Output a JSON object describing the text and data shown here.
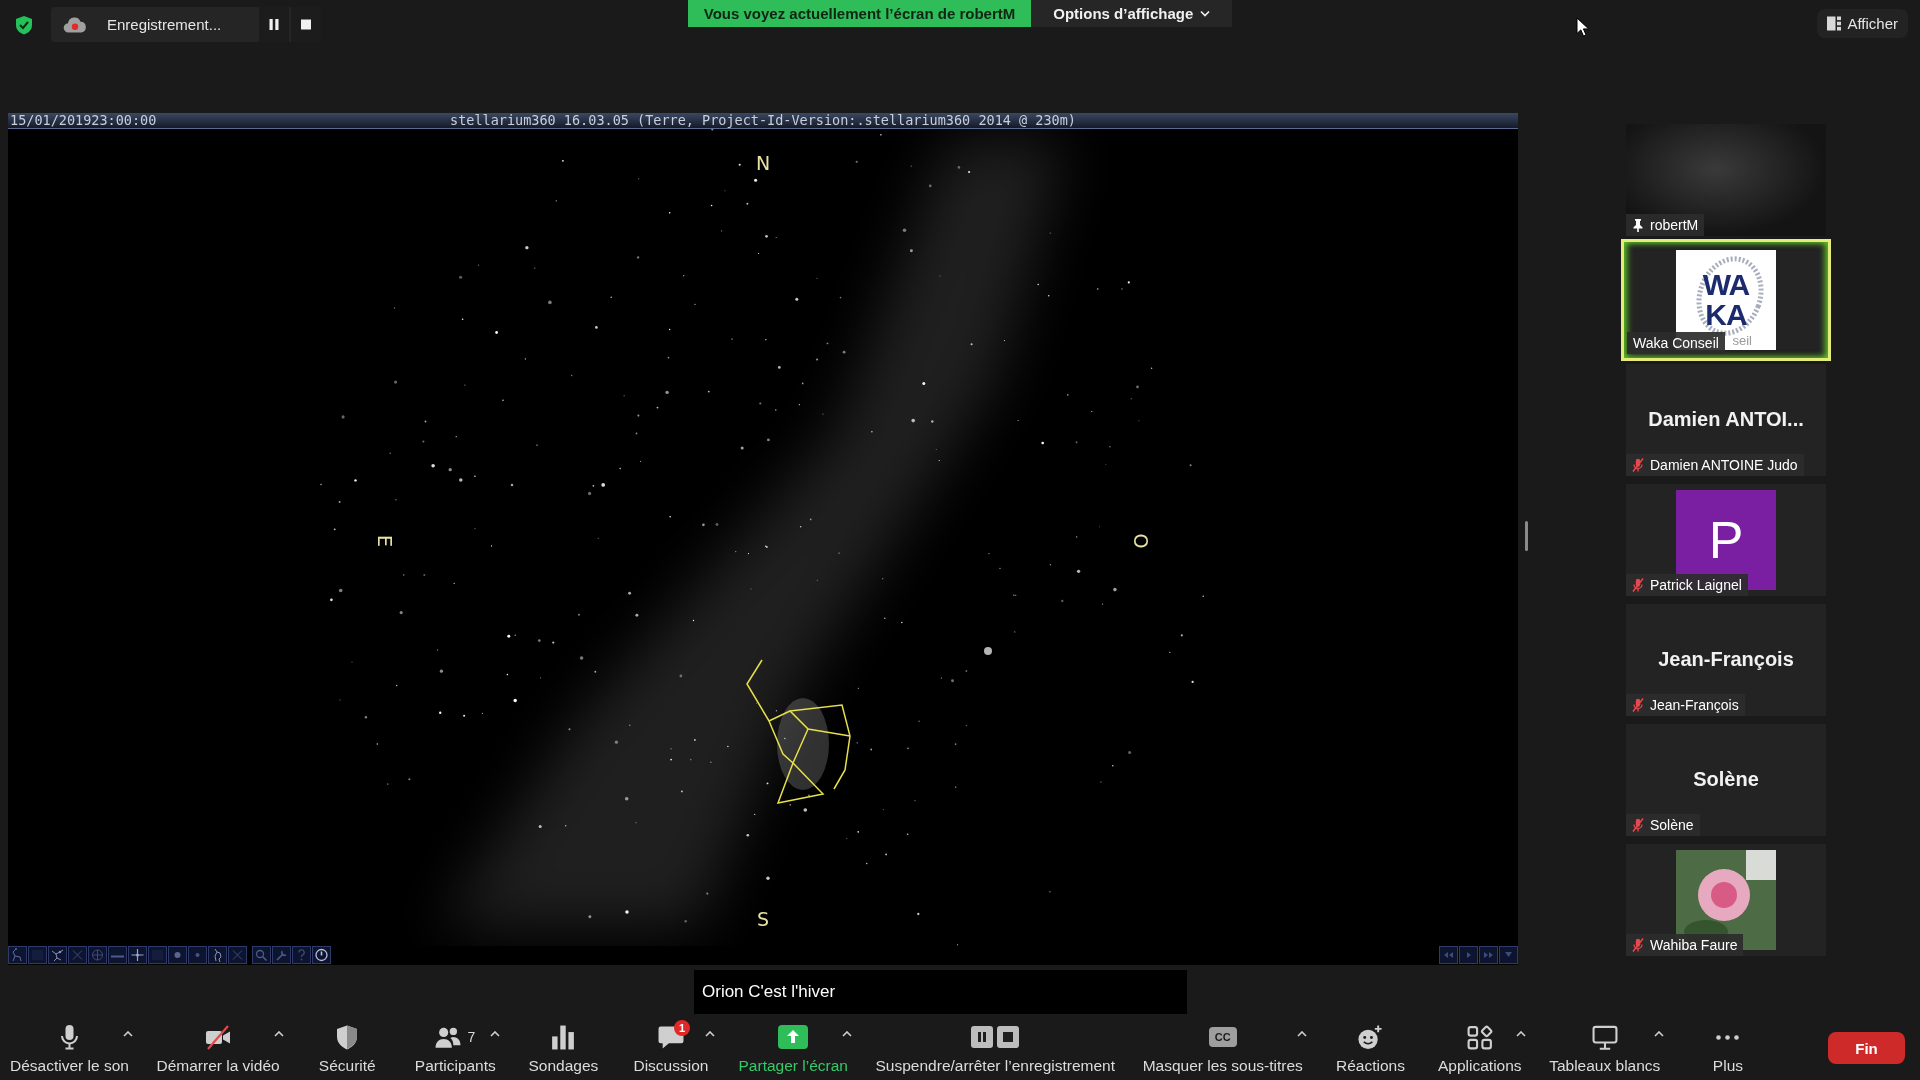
{
  "top_bar": {
    "recording": {
      "label": "Enregistrement..."
    },
    "banner": "Vous voyez actuellement l’écran de robertM",
    "view_options": "Options d’affichage",
    "side_panel_button": "Afficher"
  },
  "shared_screen": {
    "timestamp": "15/01/201923:00:00",
    "title": "stellarium360 16.03.05 (Terre, Project-Id-Version:.stellarium360 2014 @ 230m)",
    "compass": [
      "N",
      "E",
      "O",
      "S"
    ],
    "caption": "Orion C'est l'hiver"
  },
  "participants": [
    {
      "name": "robertM",
      "kind": "video",
      "pinned": true,
      "muted": false,
      "active_speaker": false
    },
    {
      "name": "Waka Conseil",
      "kind": "logo",
      "logo": {
        "lines": [
          "WA",
          "KA"
        ],
        "tagline": "seil"
      },
      "pinned": false,
      "muted": false,
      "active_speaker": true
    },
    {
      "name": "Damien ANTOINE Judo",
      "kind": "name",
      "display_name": "Damien ANTOI...",
      "pinned": false,
      "muted": true,
      "active_speaker": false
    },
    {
      "name": "Patrick Laignel",
      "kind": "letter",
      "initial": "P",
      "pinned": false,
      "muted": true,
      "active_speaker": false
    },
    {
      "name": "Jean-François",
      "kind": "name",
      "display_name": "Jean-François",
      "pinned": false,
      "muted": true,
      "active_speaker": false
    },
    {
      "name": "Solène",
      "kind": "name",
      "display_name": "Solène",
      "pinned": false,
      "muted": true,
      "active_speaker": false
    },
    {
      "name": "Wahiba Faure",
      "kind": "photo",
      "pinned": false,
      "muted": true,
      "active_speaker": false
    }
  ],
  "toolbar": {
    "items": [
      {
        "kind": "mic",
        "label": "Désactiver le son",
        "menu": true
      },
      {
        "kind": "video",
        "label": "Démarrer la vidéo",
        "menu": true
      },
      {
        "kind": "security",
        "label": "Sécurité",
        "menu": false
      },
      {
        "kind": "participants",
        "label": "Participants",
        "count": "7",
        "menu": true
      },
      {
        "kind": "polls",
        "label": "Sondages",
        "menu": false
      },
      {
        "kind": "chat",
        "label": "Discussion",
        "badge": "1",
        "menu": true
      },
      {
        "kind": "share",
        "label": "Partager l’écran",
        "menu": true
      },
      {
        "kind": "record",
        "label": "Suspendre/arrêter l’enregistrement",
        "menu": false
      },
      {
        "kind": "captions",
        "label": "Masquer les sous-titres",
        "icon_text": "CC",
        "menu": true
      },
      {
        "kind": "reactions",
        "label": "Réactions",
        "menu": false
      },
      {
        "kind": "apps",
        "label": "Applications",
        "menu": true
      },
      {
        "kind": "whiteboard",
        "label": "Tableaux blancs",
        "menu": true
      },
      {
        "kind": "more",
        "label": "Plus",
        "menu": false
      }
    ],
    "end_button": "Fin"
  }
}
